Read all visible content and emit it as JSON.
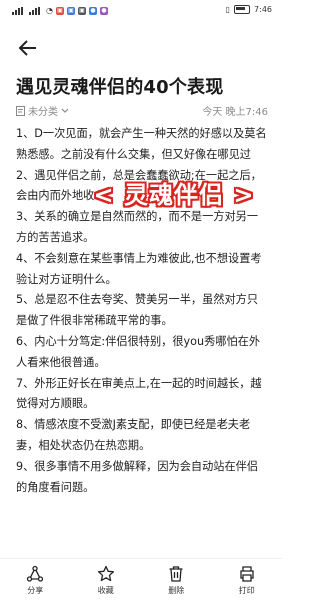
{
  "status_bar": {
    "carrier_icons": [
      "sim-signal-icon",
      "sim-signal-icon",
      "wifi-icon",
      "app-notification-icons"
    ],
    "right_icons": [
      "no-sim-icon",
      "battery-icon"
    ],
    "time": "7:46"
  },
  "article": {
    "title": "遇见灵魂伴侣的40个表现",
    "category": "未分类",
    "timestamp": "今天 晚上7:46",
    "banner": "< 灵魂伴侣 >",
    "paragraphs": [
      "1、D一次见面，就会产生一种天然的好感以及莫名熟悉感。之前没有什么交集，但又好像在哪见过",
      "2、遇见伴侣之前，总是会蠢蠢欲动;在一起之后，会由内而外地收心。",
      "3、关系的确立是自然而然的，而不是一方对另一方的苦苦追求。",
      "4、不会刻意在某些事情上为难彼此,也不想设置考验让对方证明什么。",
      "5、总是忍不住去夸奖、赞美另一半，虽然对方只是做了件很非常稀疏平常的事。",
      "6、内心十分笃定:伴侣很特别，很you秀哪怕在外人看来他很普通。",
      "7、外形正好长在审美点上,在一起的时间越长，越觉得对方顺眼。",
      "8、情感浓度不受激J素支配，即使已经是老夫老妻，相处状态仍在热恋期。",
      "9、很多事情不用多做解释，因为会自动站在伴侣的角度看问题。"
    ]
  },
  "toolbar": {
    "items": [
      {
        "label": "分享",
        "icon": "share-icon"
      },
      {
        "label": "收藏",
        "icon": "star-icon"
      },
      {
        "label": "删除",
        "icon": "trash-icon"
      },
      {
        "label": "打印",
        "icon": "print-icon"
      }
    ]
  },
  "colors": {
    "banner_outline": "#d9241f",
    "text": "#1e1e1e",
    "meta": "#8a8a8a"
  }
}
